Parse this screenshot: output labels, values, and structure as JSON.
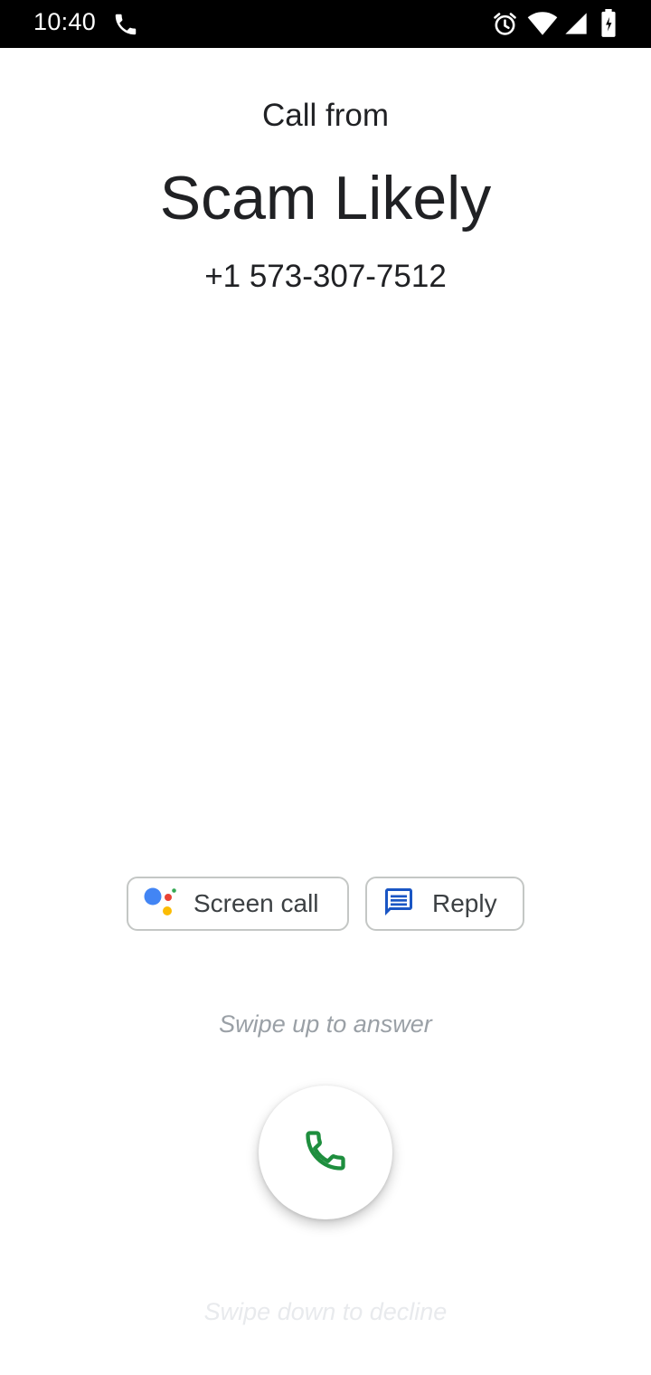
{
  "status_bar": {
    "time": "10:40",
    "icons": [
      "phone-call-icon",
      "alarm-icon",
      "wifi-icon",
      "cell-signal-icon",
      "battery-icon"
    ]
  },
  "call": {
    "header": "Call from",
    "caller_name": "Scam Likely",
    "caller_number": "+1 573-307-7512"
  },
  "actions": {
    "screen_call_label": "Screen call",
    "screen_call_icon": "google-assistant-icon",
    "reply_label": "Reply",
    "reply_icon": "message-icon"
  },
  "hints": {
    "swipe_up": "Swipe up to answer",
    "swipe_down": "Swipe down to decline"
  },
  "answer": {
    "icon": "phone-icon"
  },
  "colors": {
    "answer_green": "#1e8e3e",
    "reply_blue": "#1a56c4",
    "assistant_blue": "#4285f4",
    "assistant_red": "#ea4335",
    "assistant_yellow": "#fbbc04",
    "assistant_green": "#34a853",
    "status_bar_bg": "#000000"
  }
}
